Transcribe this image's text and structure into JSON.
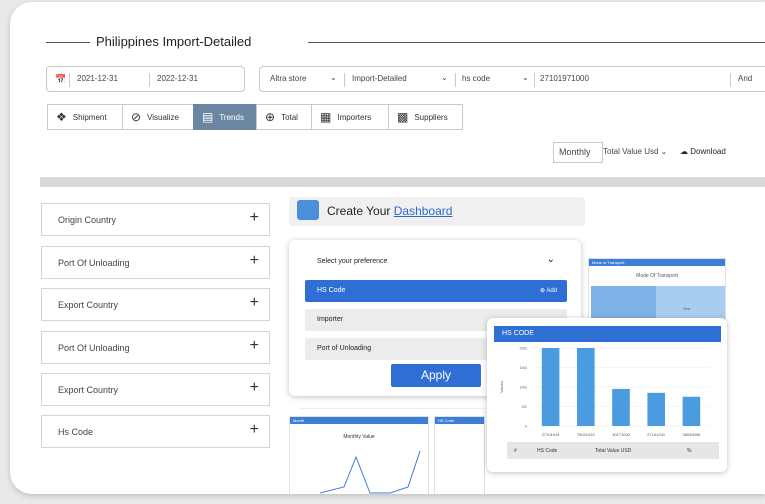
{
  "page_title": "Philippines Import-Detailed",
  "date_range": {
    "start": "2021-12-31",
    "end": "2022-12-31"
  },
  "filters": {
    "source": "Altra store",
    "report": "Import-Detailed",
    "field": "hs code",
    "value": "27101971000",
    "extra": "And"
  },
  "tabs": [
    {
      "label": "Shipment",
      "icon": "dropbox-icon"
    },
    {
      "label": "Visualize",
      "icon": "eye-off-icon"
    },
    {
      "label": "Trends",
      "icon": "area-chart-icon",
      "active": true
    },
    {
      "label": "Total",
      "icon": "plus-circle-icon"
    },
    {
      "label": "Importers",
      "icon": "sitemap-icon"
    },
    {
      "label": "Suppliers",
      "icon": "network-icon"
    }
  ],
  "toolbar": {
    "period": "Monthly",
    "metric": "Total Value Usd",
    "download": "Download"
  },
  "sidebar": {
    "items": [
      {
        "label": "Origin Country"
      },
      {
        "label": "Port Of Unloading"
      },
      {
        "label": "Export Country"
      },
      {
        "label": "Port Of Unloading"
      },
      {
        "label": "Export Country"
      },
      {
        "label": "Hs Code"
      }
    ]
  },
  "dashboard": {
    "prefix": "Create Your",
    "link": "Dashboard"
  },
  "preference": {
    "heading": "Select your preference",
    "options": [
      "HS Code",
      "Importer",
      "Port of Unloading"
    ],
    "add_label": "Add",
    "apply": "Apply"
  },
  "mode_card": {
    "header": "Mode of Transport",
    "title": "Mode Of Transport",
    "value_label": "Sea"
  },
  "monthly_card": {
    "header": "Month",
    "title": "Monthly Value"
  },
  "hs_small": {
    "header": "HS Code"
  },
  "hs_chart": {
    "header": "HS CODE",
    "table_columns": [
      "#",
      "HS Code",
      "Total Value USD",
      "%"
    ]
  },
  "chart_data": {
    "type": "bar",
    "categories": [
      "27101944",
      "75021010",
      "30171000",
      "27101241",
      "38049006"
    ],
    "values": [
      20,
      20,
      9.5,
      8.5,
      7.5
    ],
    "ylabel": "Values",
    "ytick_labels": [
      "0",
      "5G",
      "10G",
      "15G",
      "20G"
    ],
    "ylim": [
      0,
      20
    ],
    "grid": true
  },
  "colors": {
    "accent": "#2f6fd5",
    "active_tab": "#6b86a1",
    "bar": "#4a9be0"
  }
}
